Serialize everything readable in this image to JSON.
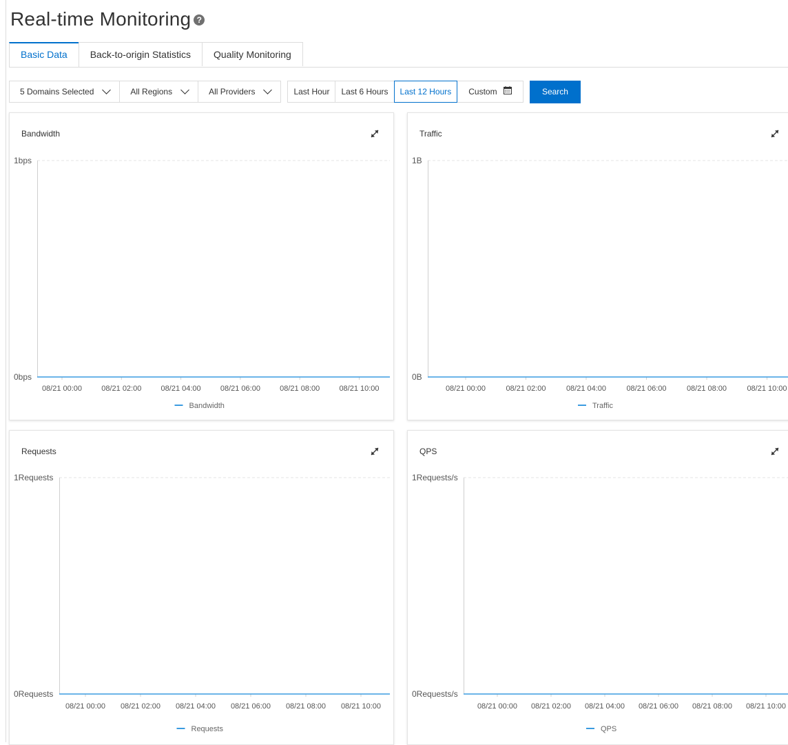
{
  "page": {
    "title": "Real-time Monitoring",
    "help_glyph": "?"
  },
  "tabs": [
    {
      "label": "Basic Data",
      "active": true
    },
    {
      "label": "Back-to-origin Statistics",
      "active": false
    },
    {
      "label": "Quality Monitoring",
      "active": false
    }
  ],
  "filters": {
    "domains": "5 Domains Selected",
    "regions": "All Regions",
    "providers": "All Providers",
    "time_ranges": [
      {
        "label": "Last Hour",
        "active": false
      },
      {
        "label": "Last 6 Hours",
        "active": false
      },
      {
        "label": "Last 12 Hours",
        "active": true
      }
    ],
    "custom": "Custom",
    "search": "Search"
  },
  "colors": {
    "accent": "#0070cc",
    "series": "#3a9be0",
    "border": "#dcdcdc"
  },
  "chart_data": [
    {
      "type": "line",
      "title": "Bandwidth",
      "x": [
        "08/21 00:00",
        "08/21 02:00",
        "08/21 04:00",
        "08/21 06:00",
        "08/21 08:00",
        "08/21 10:00"
      ],
      "yticks": [
        "1bps",
        "0bps"
      ],
      "ylim": [
        0,
        1
      ],
      "series": [
        {
          "name": "Bandwidth",
          "values": [
            0,
            0,
            0,
            0,
            0,
            0
          ]
        }
      ],
      "grid": true,
      "legend": "bottom"
    },
    {
      "type": "line",
      "title": "Traffic",
      "x": [
        "08/21 00:00",
        "08/21 02:00",
        "08/21 04:00",
        "08/21 06:00",
        "08/21 08:00",
        "08/21 10:00"
      ],
      "yticks": [
        "1B",
        "0B"
      ],
      "ylim": [
        0,
        1
      ],
      "series": [
        {
          "name": "Traffic",
          "values": [
            0,
            0,
            0,
            0,
            0,
            0
          ]
        }
      ],
      "grid": true,
      "legend": "bottom"
    },
    {
      "type": "line",
      "title": "Requests",
      "x": [
        "08/21 00:00",
        "08/21 02:00",
        "08/21 04:00",
        "08/21 06:00",
        "08/21 08:00",
        "08/21 10:00"
      ],
      "yticks": [
        "1Requests",
        "0Requests"
      ],
      "ylim": [
        0,
        1
      ],
      "series": [
        {
          "name": "Requests",
          "values": [
            0,
            0,
            0,
            0,
            0,
            0
          ]
        }
      ],
      "grid": true,
      "legend": "bottom"
    },
    {
      "type": "line",
      "title": "QPS",
      "x": [
        "08/21 00:00",
        "08/21 02:00",
        "08/21 04:00",
        "08/21 06:00",
        "08/21 08:00",
        "08/21 10:00"
      ],
      "yticks": [
        "1Requests/s",
        "0Requests/s"
      ],
      "ylim": [
        0,
        1
      ],
      "series": [
        {
          "name": "QPS",
          "values": [
            0,
            0,
            0,
            0,
            0,
            0
          ]
        }
      ],
      "grid": true,
      "legend": "bottom"
    }
  ]
}
